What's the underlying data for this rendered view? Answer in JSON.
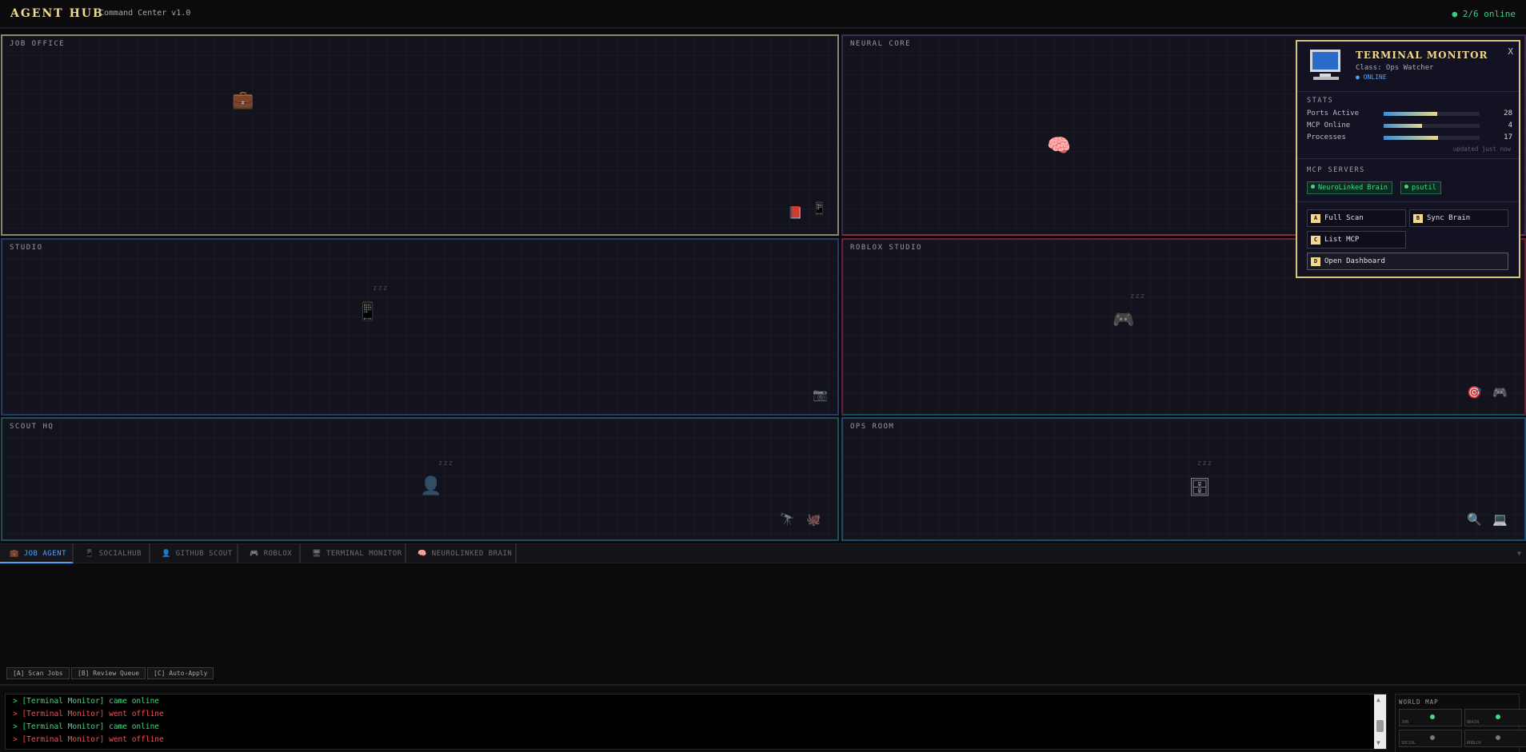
{
  "header": {
    "brand": "AGENT HUB",
    "subtitle": "Command Center v1.0",
    "online": "● 2/6 online"
  },
  "rooms": {
    "job": {
      "label": "JOB OFFICE",
      "agent_icon": "briefcase-icon",
      "agent": "💼",
      "props": [
        "📕",
        "📱"
      ]
    },
    "neural": {
      "label": "NEURAL CORE",
      "agent_icon": "brain-icon",
      "agent": "🧠"
    },
    "studio": {
      "label": "STUDIO",
      "agent_icon": "phone-keypad-icon",
      "agent": "📱",
      "zzz": "zzz",
      "props": [
        "📷"
      ]
    },
    "roblox": {
      "label": "ROBLOX STUDIO",
      "agent_icon": "gamepad-icon",
      "agent": "🎮",
      "zzz": "zzz",
      "props": [
        "🎯",
        "🎮"
      ]
    },
    "scout": {
      "label": "SCOUT HQ",
      "agent_icon": "person-laptop-icon",
      "agent": "👤",
      "zzz": "zzz",
      "props": [
        "🔭",
        "🐙"
      ]
    },
    "ops": {
      "label": "OPS ROOM",
      "agent_icon": "server-icon",
      "agent": "🗄",
      "zzz": "zzz",
      "props": [
        "🔍",
        "💻"
      ]
    }
  },
  "tabs": [
    {
      "icon": "💼",
      "label": "JOB AGENT",
      "active": true
    },
    {
      "icon": "📱",
      "label": "SOCIALHUB"
    },
    {
      "icon": "👤",
      "label": "GITHUB SCOUT"
    },
    {
      "icon": "🎮",
      "label": "ROBLOX"
    },
    {
      "icon": "🖥",
      "label": "TERMINAL MONITOR"
    },
    {
      "icon": "🧠",
      "label": "NEUROLINKED BRAIN"
    }
  ],
  "tab_chevron": "▼",
  "actions": [
    "[A] Scan Jobs",
    "[B] Review Queue",
    "[C] Auto-Apply"
  ],
  "log": [
    {
      "text": "> [Terminal Monitor] came online",
      "status": "ok"
    },
    {
      "text": "> [Terminal Monitor] went offline",
      "status": "bad"
    },
    {
      "text": "> [Terminal Monitor] came online",
      "status": "ok"
    },
    {
      "text": "> [Terminal Monitor] went offline",
      "status": "bad"
    }
  ],
  "worldmap": {
    "title": "WORLD MAP",
    "cells": [
      {
        "label": "JOB",
        "status": "online",
        "color": "#3ddc84"
      },
      {
        "label": "BRAIN",
        "status": "online",
        "color": "#3ddc84"
      },
      {
        "label": "SOCIAL",
        "status": "offline",
        "color": "#777777"
      },
      {
        "label": "ROBLOX",
        "status": "offline",
        "color": "#777777"
      }
    ]
  },
  "popup": {
    "title": "TERMINAL MONITOR",
    "class": "Class: Ops Watcher",
    "status": "● ONLINE",
    "close": "X",
    "stats_title": "STATS",
    "stats": [
      {
        "label": "Ports Active",
        "value": "28",
        "fraction": 0.56
      },
      {
        "label": "MCP Online",
        "value": "4",
        "fraction": 0.4
      },
      {
        "label": "Processes",
        "value": "17",
        "fraction": 0.57
      }
    ],
    "updated": "updated just now",
    "mcp_title": "MCP SERVERS",
    "mcp": [
      "NeuroLinked Brain",
      "psutil"
    ],
    "buttons": [
      {
        "key": "A",
        "label": "Full Scan"
      },
      {
        "key": "B",
        "label": "Sync Brain"
      },
      {
        "key": "C",
        "label": "List MCP"
      },
      {
        "key": "D",
        "label": "Open Dashboard"
      }
    ]
  },
  "colors": {
    "accent": "#f3d98b",
    "tab_active": "#4ca3ff",
    "online": "#35d07f",
    "offline": "#ff4d4d"
  }
}
